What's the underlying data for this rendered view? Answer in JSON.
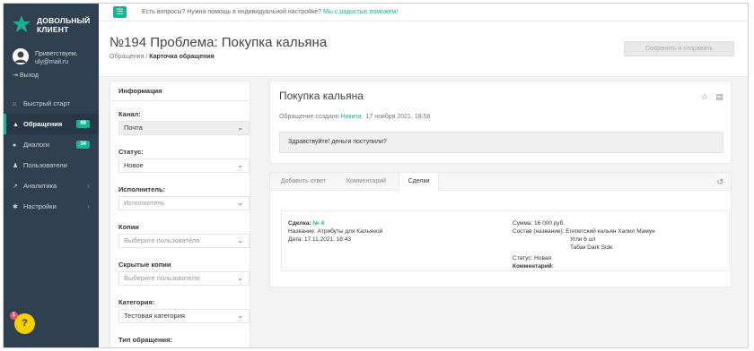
{
  "sidebar": {
    "logo_line1": "ДОВОЛЬНЫЙ",
    "logo_line2": "КЛИЕНТ",
    "greeting": "Приветствуем,",
    "email": "uly@mail.ru",
    "logout": "Выход",
    "items": [
      {
        "label": "Быстрый старт",
        "icon": "home-icon"
      },
      {
        "label": "Обращения",
        "icon": "warning-icon",
        "badge": "99",
        "active": true
      },
      {
        "label": "Диалоги",
        "icon": "chat-icon",
        "badge": "34"
      },
      {
        "label": "Пользователи",
        "icon": "users-icon"
      },
      {
        "label": "Аналитика",
        "icon": "chart-icon",
        "arrow": "‹"
      },
      {
        "label": "Настройки",
        "icon": "gear-icon",
        "arrow": "‹"
      }
    ],
    "help_badge": "1",
    "help_label": "?"
  },
  "topbar": {
    "menu_icon": "☰",
    "question": "Есть вопросы? Нужна помощь в индивидуальной настройке?",
    "help_link": "Мы с радостью поможем!"
  },
  "header": {
    "title": "№194 Проблема: Покупка кальяна",
    "crumb_parent": "Обращения",
    "crumb_sep": "/",
    "crumb_current": "Карточка обращения",
    "save_button": "Сохранить и отправить"
  },
  "info": {
    "title": "Информация",
    "channel_label": "Канал:",
    "channel_value": "Почта",
    "status_label": "Статус:",
    "status_value": "Новое",
    "executor_label": "Исполнитель:",
    "executor_placeholder": "Исполнитель",
    "copies_label": "Копии",
    "copies_placeholder": "Выберите пользователя",
    "hidden_copies_label": "Скрытые копии",
    "hidden_copies_placeholder": "Выберите пользователя",
    "category_label": "Категория:",
    "category_value": "Тестовая категория",
    "type_label": "Тип обращения:"
  },
  "ticket": {
    "title": "Покупка кальяна",
    "created_prefix": "Обращение создано",
    "author": "Никита",
    "created_date": "17 ноября 2021, 18:58",
    "message": "Здравствуйте! деньги поступили?"
  },
  "tabs": [
    {
      "label": "Добавить ответ"
    },
    {
      "label": "Комментарий"
    },
    {
      "label": "Сделки",
      "active": true
    }
  ],
  "deal": {
    "deal_label": "Сделка:",
    "deal_number": "№ 4",
    "name_label": "Название:",
    "name_value": "Атрибуты для Кальяной",
    "date_label": "Дата:",
    "date_value": "17.11.2021, 18:43",
    "sum_label": "Сумма:",
    "sum_value": "16 000 руб.",
    "composition_label": "Состав (название):",
    "composition_items": [
      "Египетский кальян Халил Мамун",
      "Угли 6 шт",
      "Табак Dark Side"
    ],
    "status_label": "Статус:",
    "status_value": "Новая",
    "comment_label": "Комментарий:"
  },
  "colors": {
    "sidebar": "#2f4050",
    "accent": "#1ab394",
    "badge": "#1ab394",
    "help": "#f5d000"
  }
}
